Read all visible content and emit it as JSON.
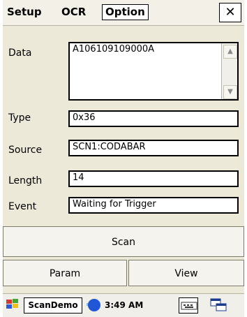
{
  "menu": {
    "setup": "Setup",
    "ocr": "OCR",
    "option": "Option",
    "close": "✕"
  },
  "fields": {
    "data_label": "Data",
    "data_value": "A106109109000A",
    "type_label": "Type",
    "type_value": "0x36",
    "source_label": "Source",
    "source_value": "SCN1:CODABAR",
    "length_label": "Length",
    "length_value": "14",
    "event_label": "Event",
    "event_value": "Waiting for Trigger"
  },
  "buttons": {
    "scan": "Scan",
    "param": "Param",
    "view": "View"
  },
  "taskbar": {
    "app": "ScanDemo",
    "time": "3:49 AM"
  }
}
